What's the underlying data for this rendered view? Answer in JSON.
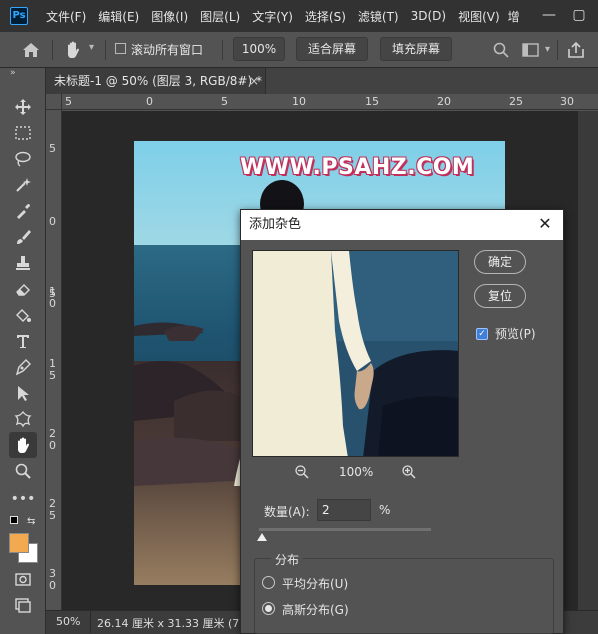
{
  "app": {
    "logo": "Ps"
  },
  "menu": [
    "文件(F)",
    "编辑(E)",
    "图像(I)",
    "图层(L)",
    "文字(Y)",
    "选择(S)",
    "滤镜(T)",
    "3D(D)",
    "视图(V)",
    "增"
  ],
  "window_controls": {
    "minimize": "—",
    "maximize": "▢"
  },
  "options_bar": {
    "scroll_all_label": "滚动所有窗口",
    "zoom_value": "100%",
    "fit_screen": "适合屏幕",
    "fill_screen": "填充屏幕"
  },
  "document": {
    "tab_title": "未标题-1 @ 50% (图层 3, RGB/8#) *",
    "tab_close": "×",
    "ruler_top": [
      "5",
      "0",
      "5",
      "10",
      "15",
      "20",
      "25",
      "30"
    ],
    "ruler_left": [
      "5",
      "0",
      "5",
      "1\n0",
      "1\n5",
      "2\n0",
      "2\n5",
      "3\n0"
    ],
    "watermark": "WWW.PSAHZ.COM"
  },
  "status": {
    "zoom": "50%",
    "doc_size": "26.14 厘米 x 31.33 厘米 (72"
  },
  "colors": {
    "foreground": "#f2a950",
    "background": "#ffffff",
    "accent": "#31a8ff"
  },
  "tools": [
    "move-icon",
    "marquee-icon",
    "lasso-icon",
    "magic-wand-icon",
    "eyedropper-icon",
    "brush-icon",
    "stamp-icon",
    "eraser-icon",
    "paint-bucket-icon",
    "type-icon",
    "pen-icon",
    "path-select-icon",
    "custom-shape-icon",
    "hand-icon",
    "zoom-icon",
    "more-icon"
  ],
  "dialog": {
    "title": "添加杂色",
    "close": "✕",
    "ok": "确定",
    "reset": "复位",
    "preview_label": "预览(P)",
    "preview_checked": true,
    "preview_zoom": "100%",
    "amount_label": "数量(A):",
    "amount_value": "2",
    "amount_unit": "%",
    "distribution_label": "分布",
    "uniform_label": "平均分布(U)",
    "gaussian_label": "高斯分布(G)",
    "selected_distribution": "gaussian"
  }
}
